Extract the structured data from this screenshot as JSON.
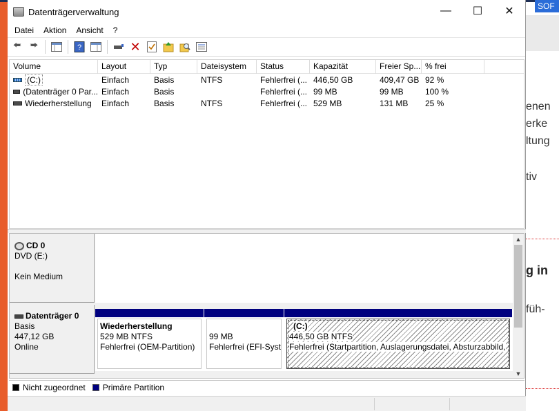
{
  "window": {
    "title": "Datenträgerverwaltung"
  },
  "menu": [
    "Datei",
    "Aktion",
    "Ansicht",
    "?"
  ],
  "columns": [
    "Volume",
    "Layout",
    "Typ",
    "Dateisystem",
    "Status",
    "Kapazität",
    "Freier Sp...",
    "% frei"
  ],
  "volumes": [
    {
      "name": "(C:)",
      "layout": "Einfach",
      "typ": "Basis",
      "fs": "NTFS",
      "status": "Fehlerfrei (...",
      "kapazitaet": "446,50 GB",
      "frei": "409,47 GB",
      "prozent": "92 %"
    },
    {
      "name": "(Datenträger 0 Par...",
      "layout": "Einfach",
      "typ": "Basis",
      "fs": "",
      "status": "Fehlerfrei (...",
      "kapazitaet": "99 MB",
      "frei": "99 MB",
      "prozent": "100 %"
    },
    {
      "name": "Wiederherstellung",
      "layout": "Einfach",
      "typ": "Basis",
      "fs": "NTFS",
      "status": "Fehlerfrei (...",
      "kapazitaet": "529 MB",
      "frei": "131 MB",
      "prozent": "25 %"
    }
  ],
  "cd": {
    "name": "CD 0",
    "type": "DVD (E:)",
    "media": "Kein Medium"
  },
  "disk0": {
    "name": "Datenträger 0",
    "type": "Basis",
    "size": "447,12 GB",
    "state": "Online",
    "partitions": [
      {
        "title": "Wiederherstellung",
        "size": "529 MB NTFS",
        "status": "Fehlerfrei (OEM-Partition)"
      },
      {
        "title": "",
        "size": "99 MB",
        "status": "Fehlerfrei (EFI-Syste"
      },
      {
        "title": "(C:)",
        "size": "446,50 GB NTFS",
        "status": "Fehlerfrei (Startpartition, Auslagerungsdatei, Absturzabbild,"
      }
    ]
  },
  "legend": {
    "unallocated": "Nicht zugeordnet",
    "primary": "Primäre Partition"
  },
  "colors": {
    "primary_partition": "#00007f",
    "unallocated": "#000000",
    "background_accent": "#e85d2b"
  },
  "background": {
    "tab": "SOF",
    "lines": [
      "enen",
      "erke",
      "ltung",
      "tiv"
    ],
    "heading": "g in",
    "line2": "füh-"
  }
}
